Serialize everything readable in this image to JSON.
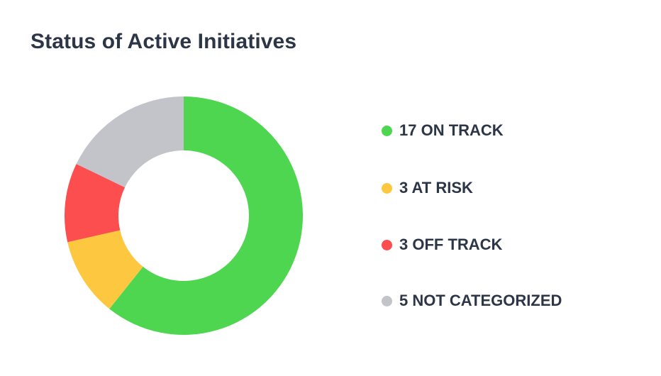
{
  "title": "Status of Active Initiatives",
  "chart_data": {
    "type": "pie",
    "variant": "donut",
    "title": "Status of Active Initiatives",
    "slices": [
      {
        "label": "ON TRACK",
        "value": 17,
        "color": "#4fd651"
      },
      {
        "label": "AT RISK",
        "value": 3,
        "color": "#fdc83f"
      },
      {
        "label": "OFF TRACK",
        "value": 3,
        "color": "#fc4d4f"
      },
      {
        "label": "NOT CATEGORIZED",
        "value": 5,
        "color": "#c2c4c9"
      }
    ],
    "legend_position": "right"
  },
  "legend": [
    {
      "text": "17 ON TRACK",
      "color": "#4fd651"
    },
    {
      "text": "3 AT RISK",
      "color": "#fdc83f"
    },
    {
      "text": "3 OFF TRACK",
      "color": "#fc4d4f"
    },
    {
      "text": "5 NOT CATEGORIZED",
      "color": "#c2c4c9"
    }
  ]
}
